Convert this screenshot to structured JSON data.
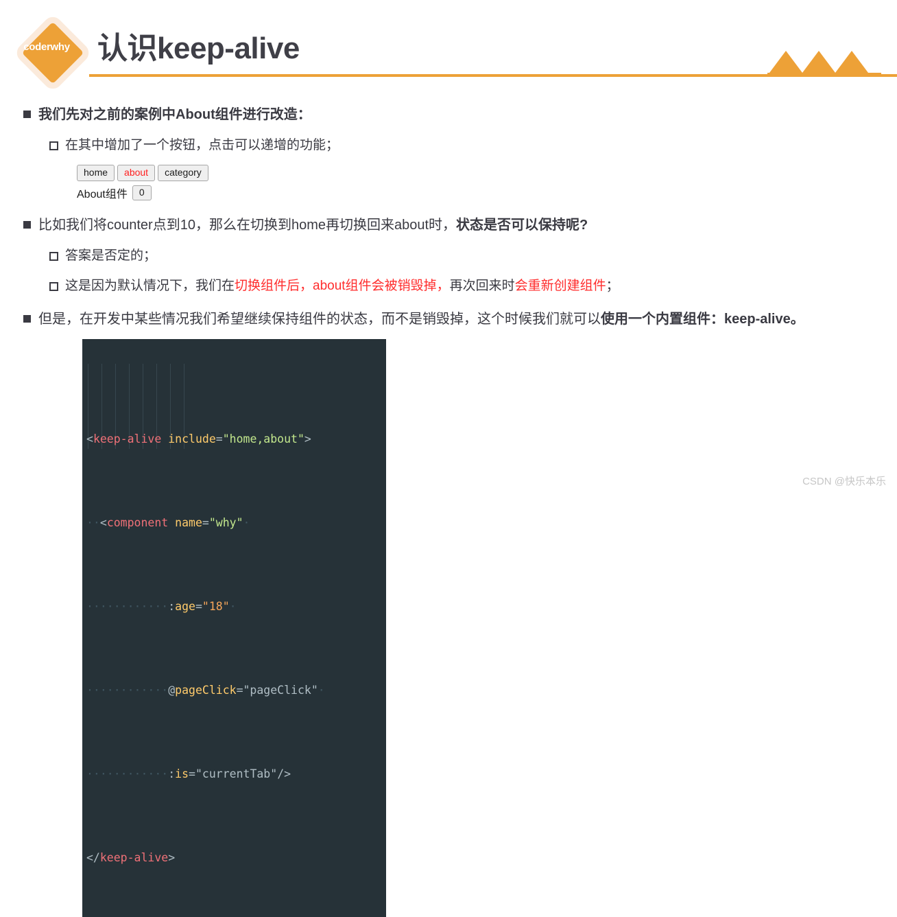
{
  "header": {
    "logo_text": "coderwhy",
    "title": "认识keep-alive"
  },
  "content": {
    "bullet1": "我们先对之前的案例中About组件进行改造：",
    "bullet1_sub1": "在其中增加了一个按钮，点击可以递增的功能；",
    "bullet2_plain": "比如我们将counter点到10，那么在切换到home再切换回来about时，",
    "bullet2_bold": "状态是否可以保持呢?",
    "bullet2_sub1": "答案是否定的；",
    "bullet2_sub2_part1": "这是因为默认情况下，我们在",
    "bullet2_sub2_red1": "切换组件后，",
    "bullet2_sub2_red2": "about组件会被销毁掉，",
    "bullet2_sub2_part2": "再次回来时",
    "bullet2_sub2_red3": "会重新创建组件",
    "bullet2_sub2_part3": "；",
    "bullet3_plain": "但是，在开发中某些情况我们希望继续保持组件的状态，而不是销毁掉，这个时候我们就可以",
    "bullet3_bold": "使用一个内置组件：keep-alive。"
  },
  "mini_app": {
    "tabs": [
      {
        "label": "home",
        "active": false
      },
      {
        "label": "about",
        "active": true
      },
      {
        "label": "category",
        "active": false
      }
    ],
    "status_label": "About组件",
    "counter_value": "0"
  },
  "code": {
    "line1": {
      "open": "<",
      "tag": "keep-alive",
      "space": " ",
      "attr": "include",
      "eq": "=",
      "string": "\"home,about\"",
      "close": ">"
    },
    "line2": {
      "indent": "··",
      "open": "<",
      "tag": "component",
      "space": " ",
      "attr": "name",
      "eq": "=",
      "string": "\"why\"",
      "trail": "·"
    },
    "line3": {
      "indent": "············",
      "colon": ":",
      "attr": "age",
      "eq": "=",
      "value": "\"18\"",
      "trail": "·"
    },
    "line4": {
      "indent": "············",
      "at": "@",
      "attr": "pageClick",
      "eq": "=",
      "value": "\"pageClick\"",
      "trail": "·"
    },
    "line5": {
      "indent": "············",
      "colon": ":",
      "attr": "is",
      "eq": "=",
      "value": "\"currentTab\"",
      "selfclose": "/>"
    },
    "line6": {
      "open": "</",
      "tag": "keep-alive",
      "close": ">"
    }
  },
  "watermark": "CSDN @快乐本乐",
  "colors": {
    "accent_orange": "#eda137",
    "highlight_red": "#ff2d2d",
    "code_background": "#263238",
    "text_dark": "#3a3a42"
  }
}
